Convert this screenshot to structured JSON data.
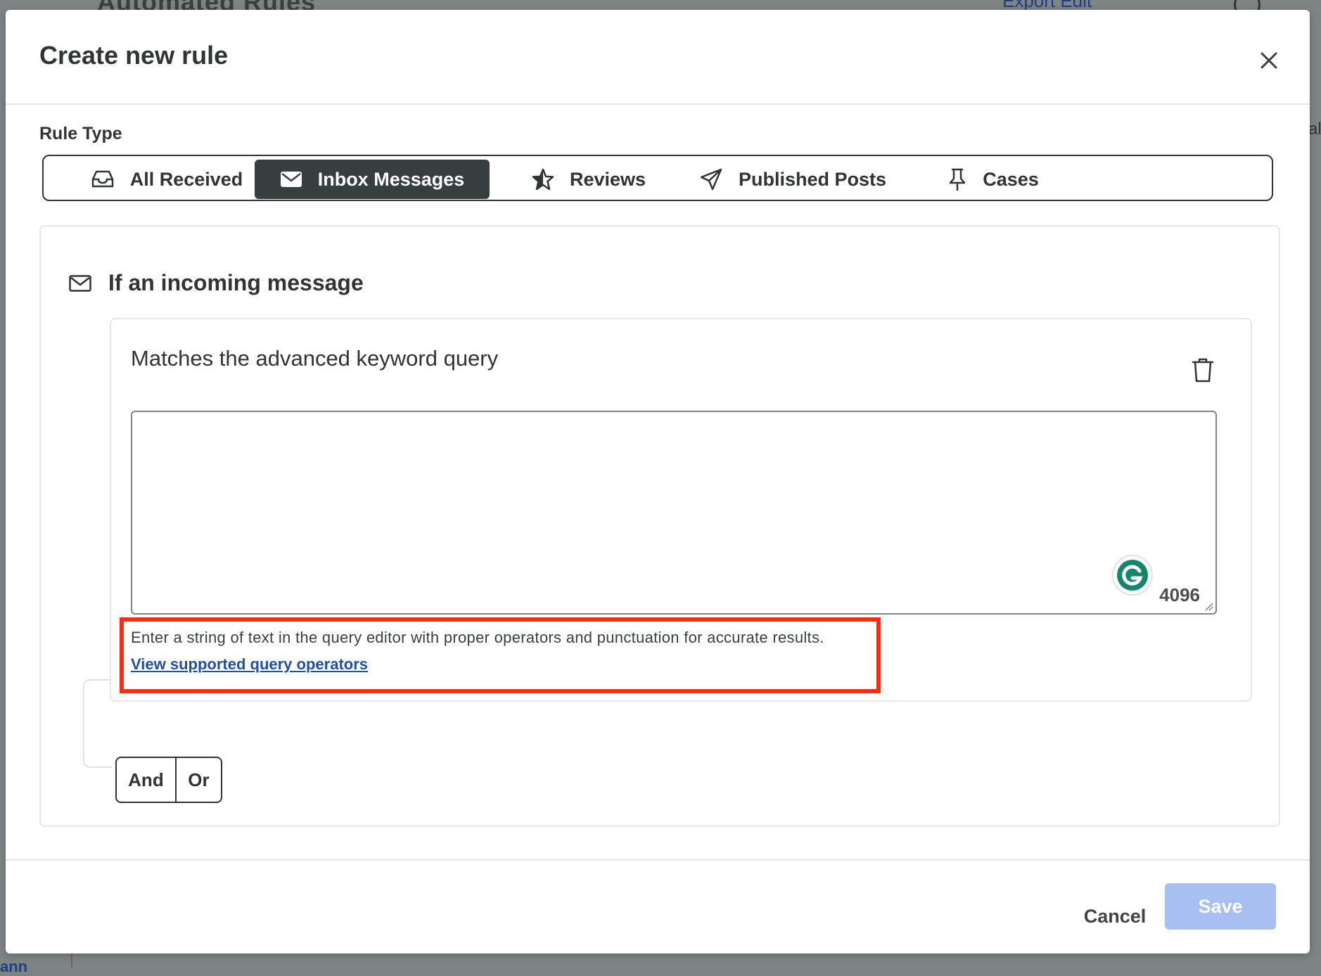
{
  "background": {
    "page_title_fragment": "Automated Rules",
    "header_link_fragment": "Export Edit",
    "bottom_fragment": "ann",
    "edge_fragment": "al"
  },
  "modal": {
    "title": "Create new rule",
    "close_icon": "close-icon"
  },
  "rule_type": {
    "label": "Rule Type",
    "tabs": [
      {
        "label": "All Received",
        "icon": "inbox-tray-icon",
        "active": false
      },
      {
        "label": "Inbox Messages",
        "icon": "envelope-icon",
        "active": true
      },
      {
        "label": "Reviews",
        "icon": "star-icon",
        "active": false
      },
      {
        "label": "Published Posts",
        "icon": "paper-plane-icon",
        "active": false
      },
      {
        "label": "Cases",
        "icon": "pin-icon",
        "active": false
      }
    ]
  },
  "rule": {
    "trigger_label": "If an incoming message",
    "trigger_icon": "envelope-icon",
    "condition": {
      "title": "Matches the advanced keyword query",
      "query_value": "",
      "char_count": "4096",
      "helper_text": "Enter a string of text in the query editor with proper operators and punctuation for accurate results.",
      "helper_link": "View supported query operators",
      "highlight_color": "#ff2a12"
    },
    "logic": {
      "and_label": "And",
      "or_label": "Or"
    }
  },
  "footer": {
    "cancel_label": "Cancel",
    "save_label": "Save",
    "save_color": "#a8bff1",
    "active_tab_color": "#373e40",
    "link_color": "#1f4fa8"
  }
}
